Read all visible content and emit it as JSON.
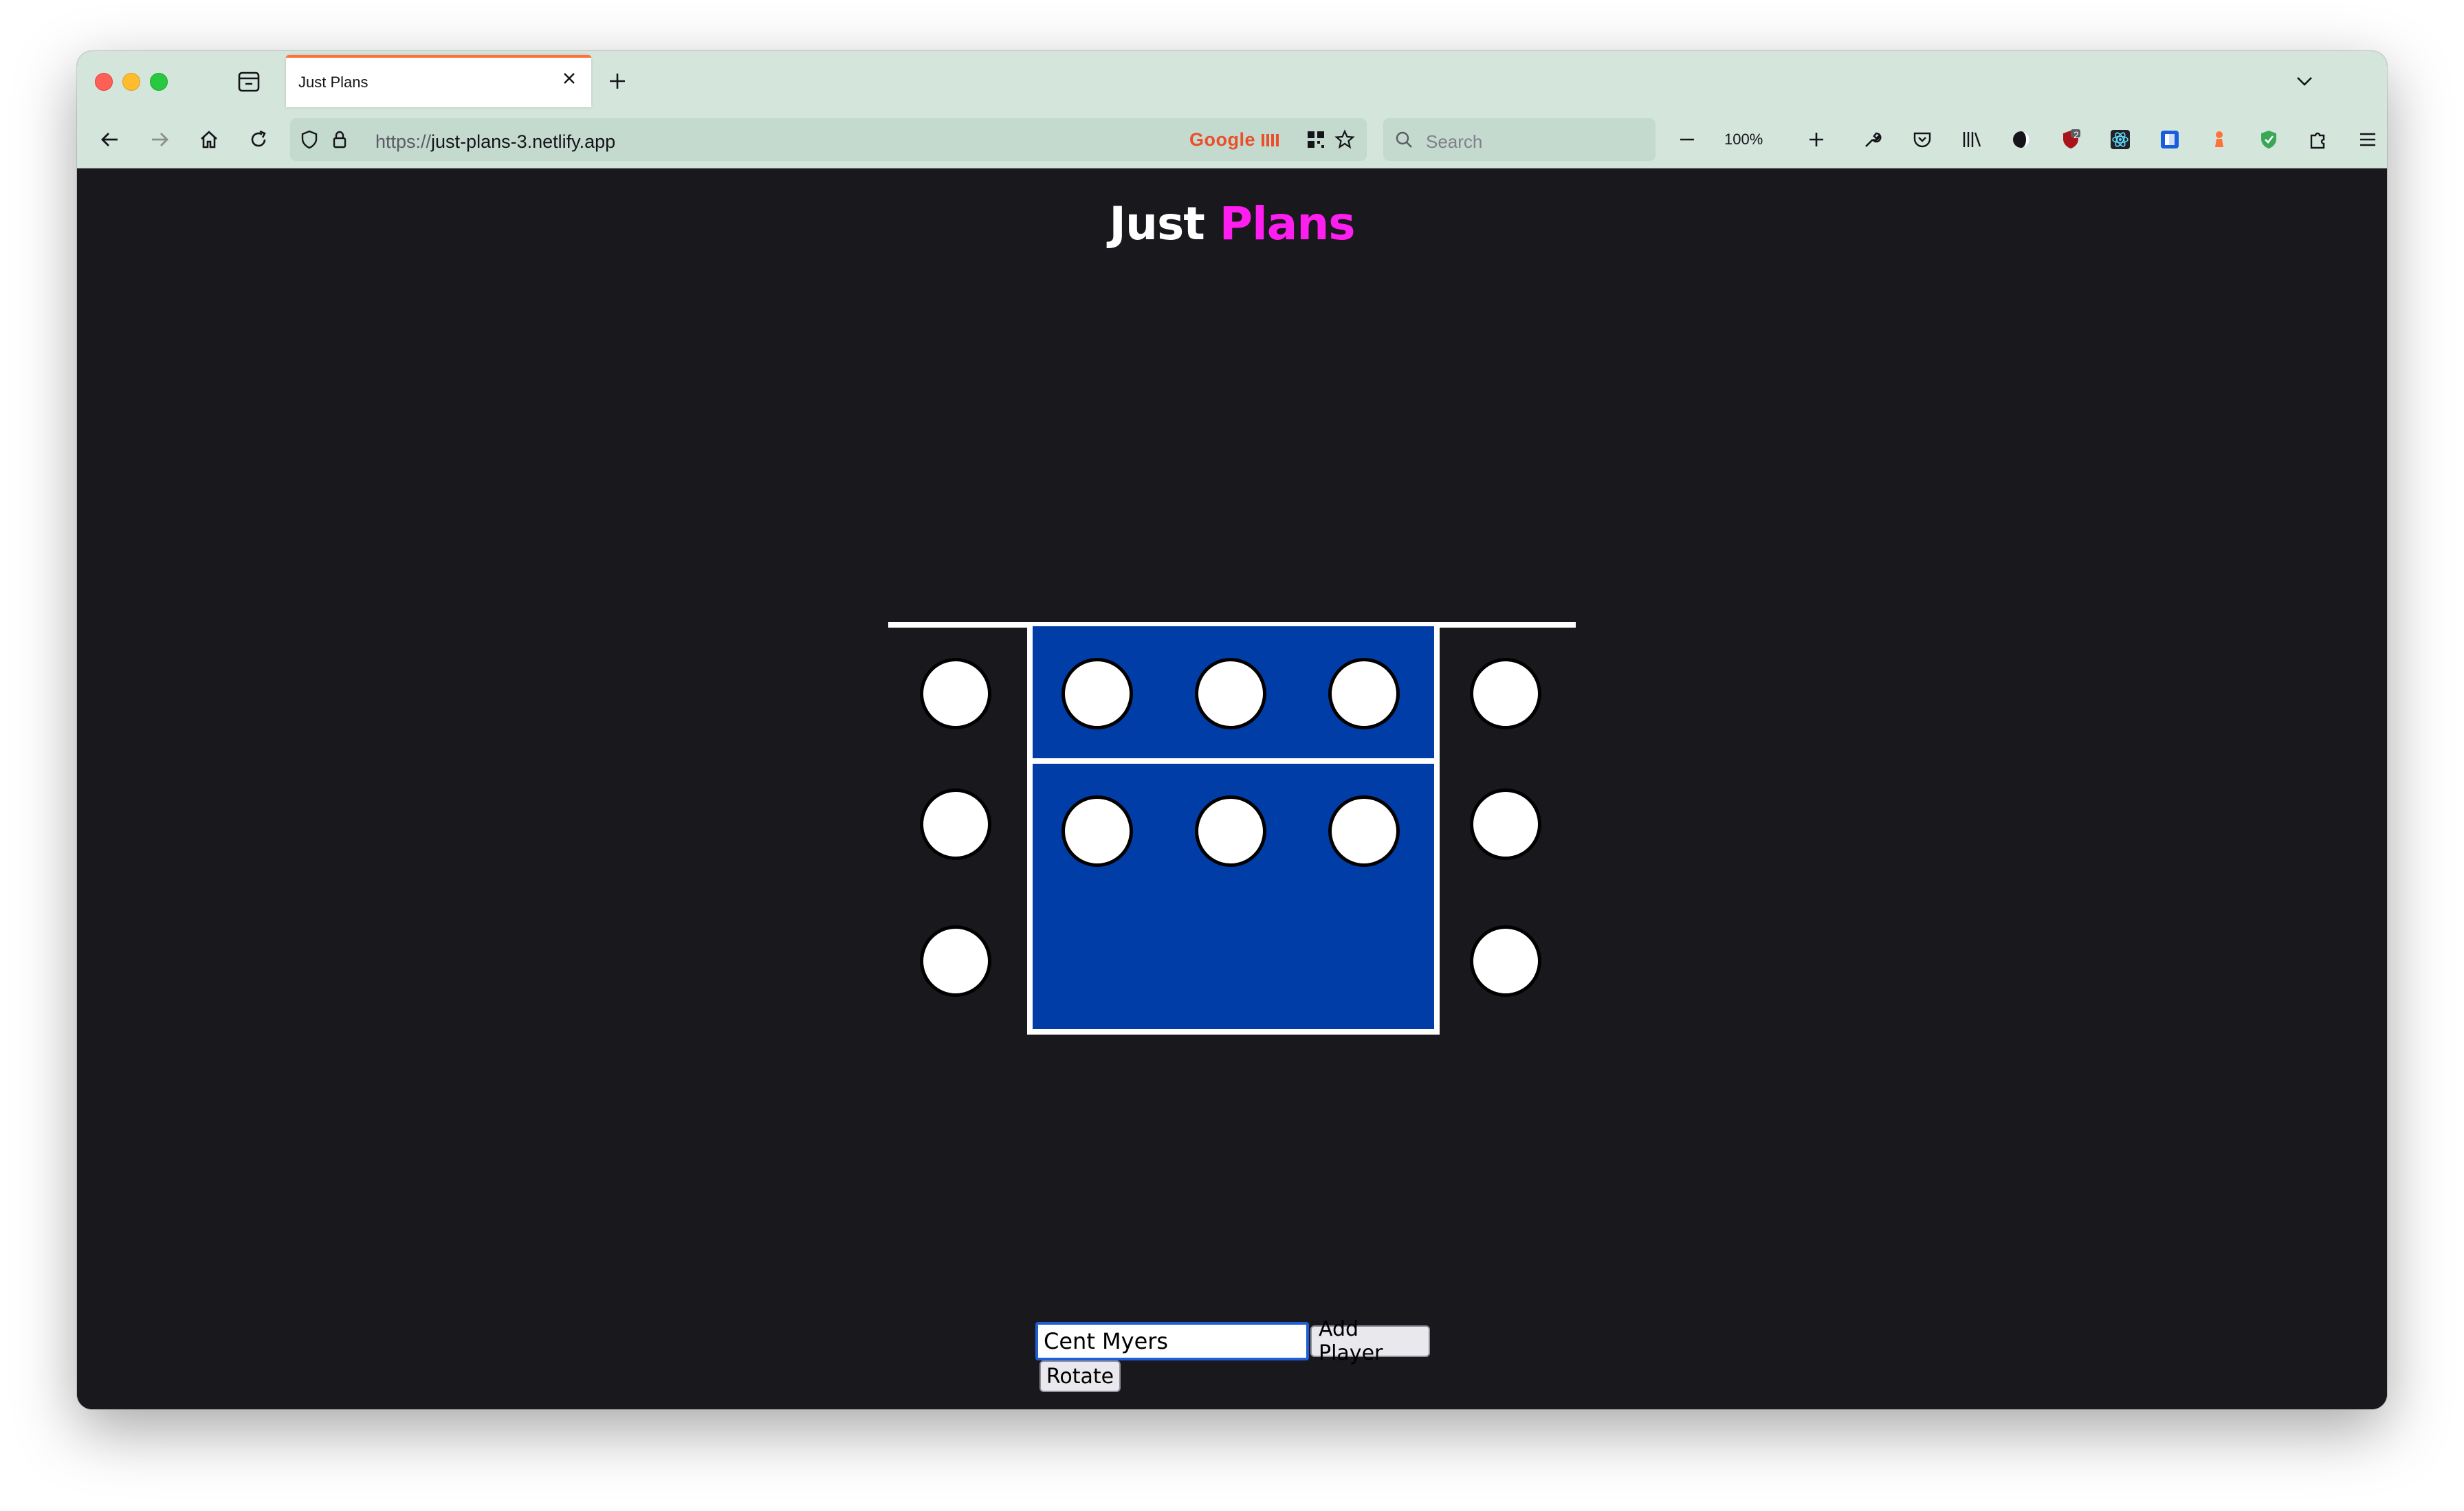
{
  "browser": {
    "tab": {
      "title": "Just Plans",
      "close_icon": "close-icon"
    },
    "url": {
      "scheme": "https://",
      "host": "just-plans-3.netlify.app"
    },
    "google_badge": "Google",
    "search_placeholder": "Search",
    "zoom": "100%",
    "toolbar_extension_badge": "2"
  },
  "app": {
    "title_part1": "Just",
    "title_part2": "Plans",
    "colors": {
      "court": "#003da6",
      "title_accent": "#ff1ef0",
      "background": "#19181d"
    },
    "players": {
      "left_bench_count": 3,
      "right_bench_count": 3,
      "front_row_count": 3,
      "back_row_count": 3
    },
    "player_input_value": "Cent Myers",
    "add_player_label": "Add Player",
    "rotate_label": "Rotate"
  }
}
